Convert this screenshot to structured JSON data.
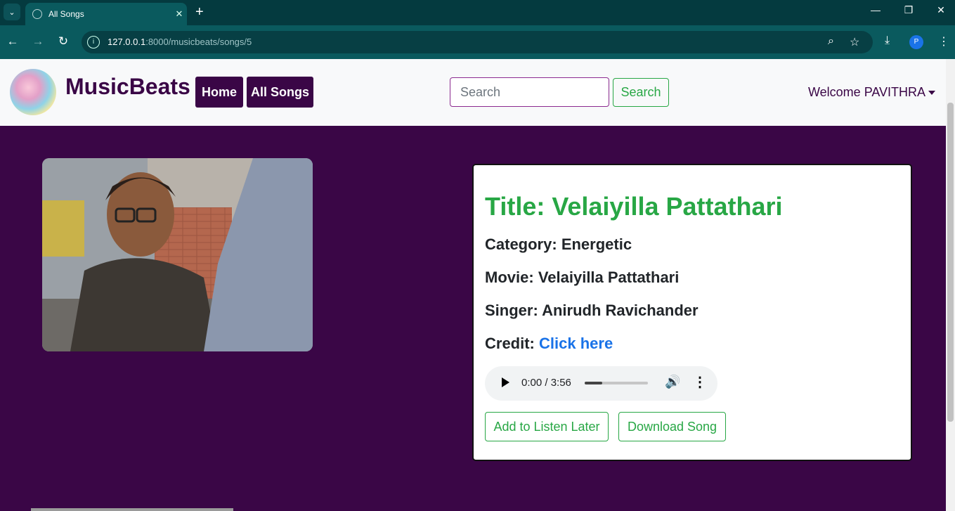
{
  "browser": {
    "tab_title": "All Songs",
    "url_host": "127.0.0.1",
    "url_rest": ":8000/musicbeats/songs/5",
    "profile_initial": "P"
  },
  "site": {
    "brand": "MusicBeats",
    "nav": {
      "home": "Home",
      "all_songs": "All Songs"
    },
    "search": {
      "placeholder": "Search",
      "button": "Search"
    },
    "welcome": "Welcome PAVITHRA"
  },
  "song": {
    "title_label": "Title:",
    "title": "Velaiyilla Pattathari",
    "category_label": "Category:",
    "category": "Energetic",
    "movie_label": "Movie:",
    "movie": "Velaiyilla Pattathari",
    "singer_label": "Singer:",
    "singer": "Anirudh Ravichander",
    "credit_label": "Credit:",
    "credit_link": "Click here"
  },
  "player": {
    "time": "0:00 / 3:56",
    "buffered_fraction": 0.28
  },
  "actions": {
    "listen_later": "Add to Listen Later",
    "download": "Download Song"
  },
  "colors": {
    "brand": "#3a0646",
    "success": "#28a745",
    "link": "#1a73e8"
  }
}
